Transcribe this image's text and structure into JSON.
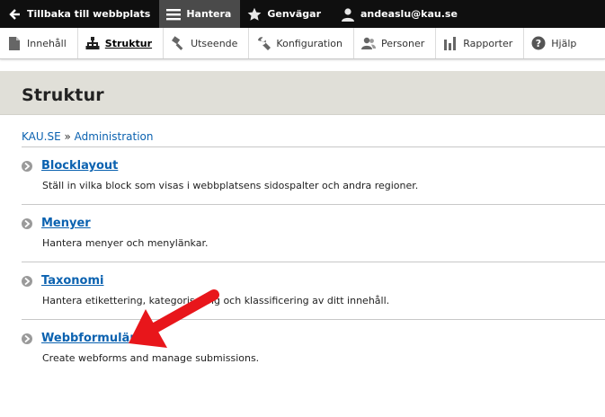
{
  "toolbar": {
    "back_label": "Tillbaka till webbplats",
    "manage_label": "Hantera",
    "shortcuts_label": "Genvägar",
    "user_label": "andeaslu@kau.se"
  },
  "tray": {
    "items": [
      {
        "label": "Innehåll",
        "icon": "document-icon"
      },
      {
        "label": "Struktur",
        "icon": "sitemap-icon"
      },
      {
        "label": "Utseende",
        "icon": "brush-icon"
      },
      {
        "label": "Konfiguration",
        "icon": "wrench-icon"
      },
      {
        "label": "Personer",
        "icon": "people-icon"
      },
      {
        "label": "Rapporter",
        "icon": "bar-chart-icon"
      },
      {
        "label": "Hjälp",
        "icon": "help-icon"
      }
    ]
  },
  "page": {
    "title": "Struktur"
  },
  "breadcrumb": {
    "home": "KAU.SE",
    "separator": "»",
    "current": "Administration"
  },
  "entries": [
    {
      "title": "Blocklayout",
      "description": "Ställ in vilka block som visas i webbplatsens sidospalter och andra regioner."
    },
    {
      "title": "Menyer",
      "description": "Hantera menyer och menylänkar."
    },
    {
      "title": "Taxonomi",
      "description": "Hantera etikettering, kategorisering och klassificering av ditt innehåll."
    },
    {
      "title": "Webbformulär",
      "description": "Create webforms and manage submissions."
    }
  ],
  "colors": {
    "link": "#0b62b0",
    "arrow": "#e8161b",
    "topbar": "#0f0f0f",
    "header_bg": "#e0dfd8"
  }
}
